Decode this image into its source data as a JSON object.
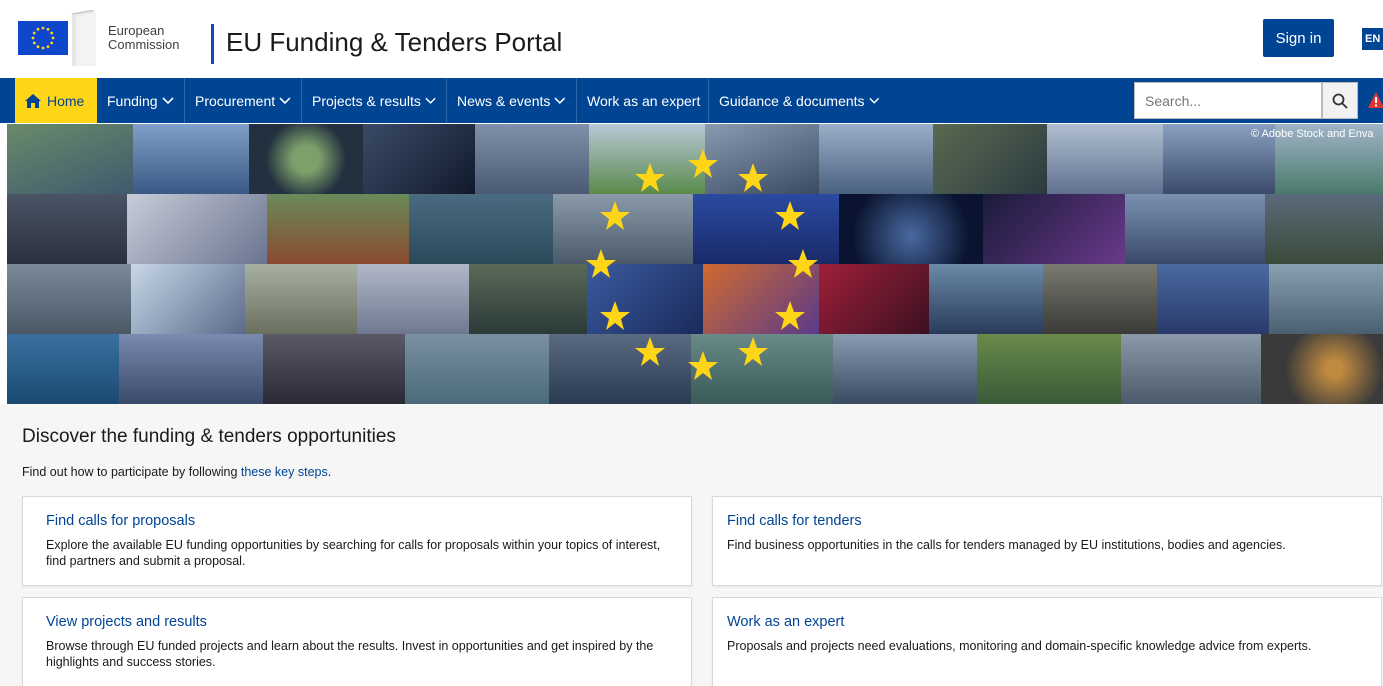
{
  "header": {
    "logo_line1": "European",
    "logo_line2": "Commission",
    "portal_title": "EU Funding & Tenders Portal",
    "signin_label": "Sign in",
    "lang_label": "EN"
  },
  "nav": {
    "items": [
      {
        "label": "Home"
      },
      {
        "label": "Funding"
      },
      {
        "label": "Procurement"
      },
      {
        "label": "Projects & results"
      },
      {
        "label": "News & events"
      },
      {
        "label": "Work as an expert"
      },
      {
        "label": "Guidance & documents"
      }
    ],
    "search_placeholder": "Search..."
  },
  "banner": {
    "copyright": "© Adobe Stock and Enva"
  },
  "main": {
    "title": "Discover the funding & tenders opportunities",
    "intro_text": "Find out how to participate by following ",
    "intro_link": "these key steps",
    "intro_end": ".",
    "cards": [
      {
        "title": "Find calls for proposals",
        "desc": "Explore the available EU funding opportunities by searching for calls for proposals within your topics of interest, find partners and submit a proposal."
      },
      {
        "title": "Find calls for tenders",
        "desc": "Find business opportunities in the calls for tenders managed by EU institutions, bodies and agencies."
      },
      {
        "title": "View projects and results",
        "desc": "Browse through EU funded projects and learn about the results. Invest in opportunities and get inspired by the highlights and success stories."
      },
      {
        "title": "Work as an expert",
        "desc": "Proposals and projects need evaluations, monitoring and domain-specific knowledge advice from experts."
      }
    ]
  },
  "colors": {
    "primary": "#004494",
    "accent": "#ffd617",
    "link": "#004494"
  }
}
